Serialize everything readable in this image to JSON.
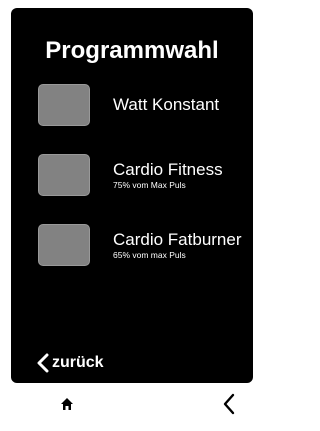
{
  "screen": {
    "title": "Programmwahl"
  },
  "programs": [
    {
      "title": "Watt Konstant",
      "subtitle": ""
    },
    {
      "title": "Cardio Fitness",
      "subtitle": "75% vom Max Puls"
    },
    {
      "title": "Cardio Fatburner",
      "subtitle": "65% vom max Puls"
    }
  ],
  "back_link": {
    "label": "zurück",
    "icon": "chevron-left-icon"
  },
  "navbar": {
    "home_icon": "home-icon",
    "back_icon": "chevron-left-icon"
  },
  "colors": {
    "screen_background": "#000000",
    "tile": "#828282",
    "text": "#ffffff",
    "navbar_background": "#ffffff"
  }
}
